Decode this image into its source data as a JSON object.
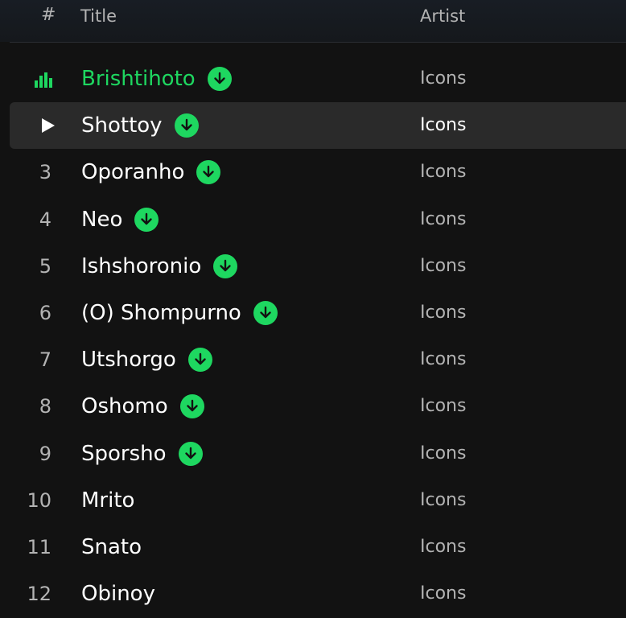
{
  "header": {
    "number": "#",
    "title": "Title",
    "artist": "Artist"
  },
  "colors": {
    "accent": "#1ed760",
    "background": "#121212",
    "hover": "#2a2a2a",
    "muted": "#b3b3b3"
  },
  "tracks": [
    {
      "number": "",
      "title": "Brishtihoto",
      "artist": "Icons",
      "downloaded": true,
      "state": "playing"
    },
    {
      "number": "",
      "title": "Shottoy",
      "artist": "Icons",
      "downloaded": true,
      "state": "hovered"
    },
    {
      "number": "3",
      "title": "Oporanho",
      "artist": "Icons",
      "downloaded": true
    },
    {
      "number": "4",
      "title": "Neo",
      "artist": "Icons",
      "downloaded": true
    },
    {
      "number": "5",
      "title": "Ishshoronio",
      "artist": "Icons",
      "downloaded": true
    },
    {
      "number": "6",
      "title": "(O) Shompurno",
      "artist": "Icons",
      "downloaded": true
    },
    {
      "number": "7",
      "title": "Utshorgo",
      "artist": "Icons",
      "downloaded": true
    },
    {
      "number": "8",
      "title": "Oshomo",
      "artist": "Icons",
      "downloaded": true
    },
    {
      "number": "9",
      "title": "Sporsho",
      "artist": "Icons",
      "downloaded": true
    },
    {
      "number": "10",
      "title": "Mrito",
      "artist": "Icons",
      "downloaded": false
    },
    {
      "number": "11",
      "title": "Snato",
      "artist": "Icons",
      "downloaded": false
    },
    {
      "number": "12",
      "title": "Obinoy",
      "artist": "Icons",
      "downloaded": false
    }
  ]
}
